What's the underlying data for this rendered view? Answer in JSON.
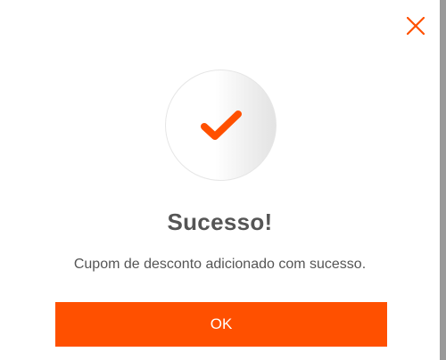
{
  "modal": {
    "title": "Sucesso!",
    "message": "Cupom de desconto adicionado com sucesso.",
    "ok_label": "OK",
    "close_icon": "close-icon",
    "status_icon": "checkmark-icon"
  },
  "colors": {
    "accent": "#ff5000",
    "text": "#555555",
    "background": "#ffffff"
  }
}
